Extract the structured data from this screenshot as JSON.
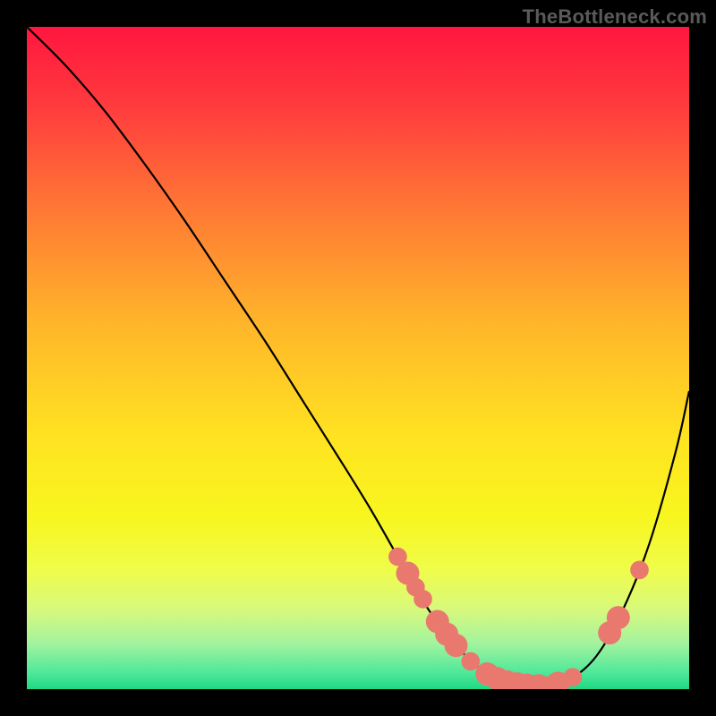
{
  "watermark": "TheBottleneck.com",
  "chart_data": {
    "type": "line",
    "title": "",
    "xlabel": "",
    "ylabel": "",
    "xlim": [
      0,
      100
    ],
    "ylim": [
      0,
      100
    ],
    "grid": false,
    "legend": false,
    "background_gradient_stops": [
      {
        "offset": 0.0,
        "color": "#ff163f"
      },
      {
        "offset": 0.12,
        "color": "#ff3b3e"
      },
      {
        "offset": 0.28,
        "color": "#ff7a34"
      },
      {
        "offset": 0.45,
        "color": "#ffb62a"
      },
      {
        "offset": 0.62,
        "color": "#ffe321"
      },
      {
        "offset": 0.74,
        "color": "#f8f61f"
      },
      {
        "offset": 0.82,
        "color": "#effc4a"
      },
      {
        "offset": 0.88,
        "color": "#d7f97d"
      },
      {
        "offset": 0.93,
        "color": "#a4f39e"
      },
      {
        "offset": 0.975,
        "color": "#4fe89a"
      },
      {
        "offset": 1.0,
        "color": "#1fd883"
      }
    ],
    "series": [
      {
        "name": "bottleneck-curve",
        "color": "#000000",
        "x": [
          0,
          6,
          12,
          18,
          24,
          30,
          36,
          42,
          48,
          52,
          56,
          60,
          64,
          68,
          72,
          74,
          78,
          82,
          86,
          90,
          94,
          98,
          100
        ],
        "y": [
          100,
          94,
          87,
          79,
          70.5,
          61.5,
          52.5,
          43,
          33.5,
          27,
          20,
          13,
          7.5,
          3.5,
          1.3,
          0.7,
          0.5,
          1.5,
          5,
          12,
          22,
          36,
          45
        ]
      }
    ],
    "markers": [
      {
        "name": "curve-marker",
        "x": 56.0,
        "y": 20.0,
        "r": 1.1
      },
      {
        "name": "curve-marker",
        "x": 57.5,
        "y": 17.5,
        "r": 1.5
      },
      {
        "name": "curve-marker",
        "x": 58.7,
        "y": 15.4,
        "r": 1.1
      },
      {
        "name": "curve-marker",
        "x": 59.8,
        "y": 13.6,
        "r": 1.1
      },
      {
        "name": "curve-marker",
        "x": 62.0,
        "y": 10.2,
        "r": 1.5
      },
      {
        "name": "curve-marker",
        "x": 63.4,
        "y": 8.3,
        "r": 1.5
      },
      {
        "name": "curve-marker",
        "x": 64.8,
        "y": 6.6,
        "r": 1.5
      },
      {
        "name": "curve-marker",
        "x": 67.0,
        "y": 4.2,
        "r": 1.1
      },
      {
        "name": "curve-marker",
        "x": 69.5,
        "y": 2.3,
        "r": 1.5
      },
      {
        "name": "curve-marker",
        "x": 71.0,
        "y": 1.6,
        "r": 1.5
      },
      {
        "name": "curve-marker",
        "x": 72.5,
        "y": 1.1,
        "r": 1.5
      },
      {
        "name": "curve-marker",
        "x": 74.0,
        "y": 0.8,
        "r": 1.5
      },
      {
        "name": "curve-marker",
        "x": 75.5,
        "y": 0.6,
        "r": 1.5
      },
      {
        "name": "curve-marker",
        "x": 77.3,
        "y": 0.5,
        "r": 1.5
      },
      {
        "name": "curve-marker",
        "x": 79.0,
        "y": 0.6,
        "r": 1.1
      },
      {
        "name": "curve-marker",
        "x": 80.2,
        "y": 0.9,
        "r": 1.5
      },
      {
        "name": "curve-marker",
        "x": 82.4,
        "y": 1.8,
        "r": 1.1
      },
      {
        "name": "curve-marker",
        "x": 88.0,
        "y": 8.5,
        "r": 1.5
      },
      {
        "name": "curve-marker",
        "x": 89.3,
        "y": 10.8,
        "r": 1.5
      },
      {
        "name": "curve-marker",
        "x": 92.5,
        "y": 18.0,
        "r": 1.1
      }
    ],
    "marker_color": "#e9796f"
  }
}
